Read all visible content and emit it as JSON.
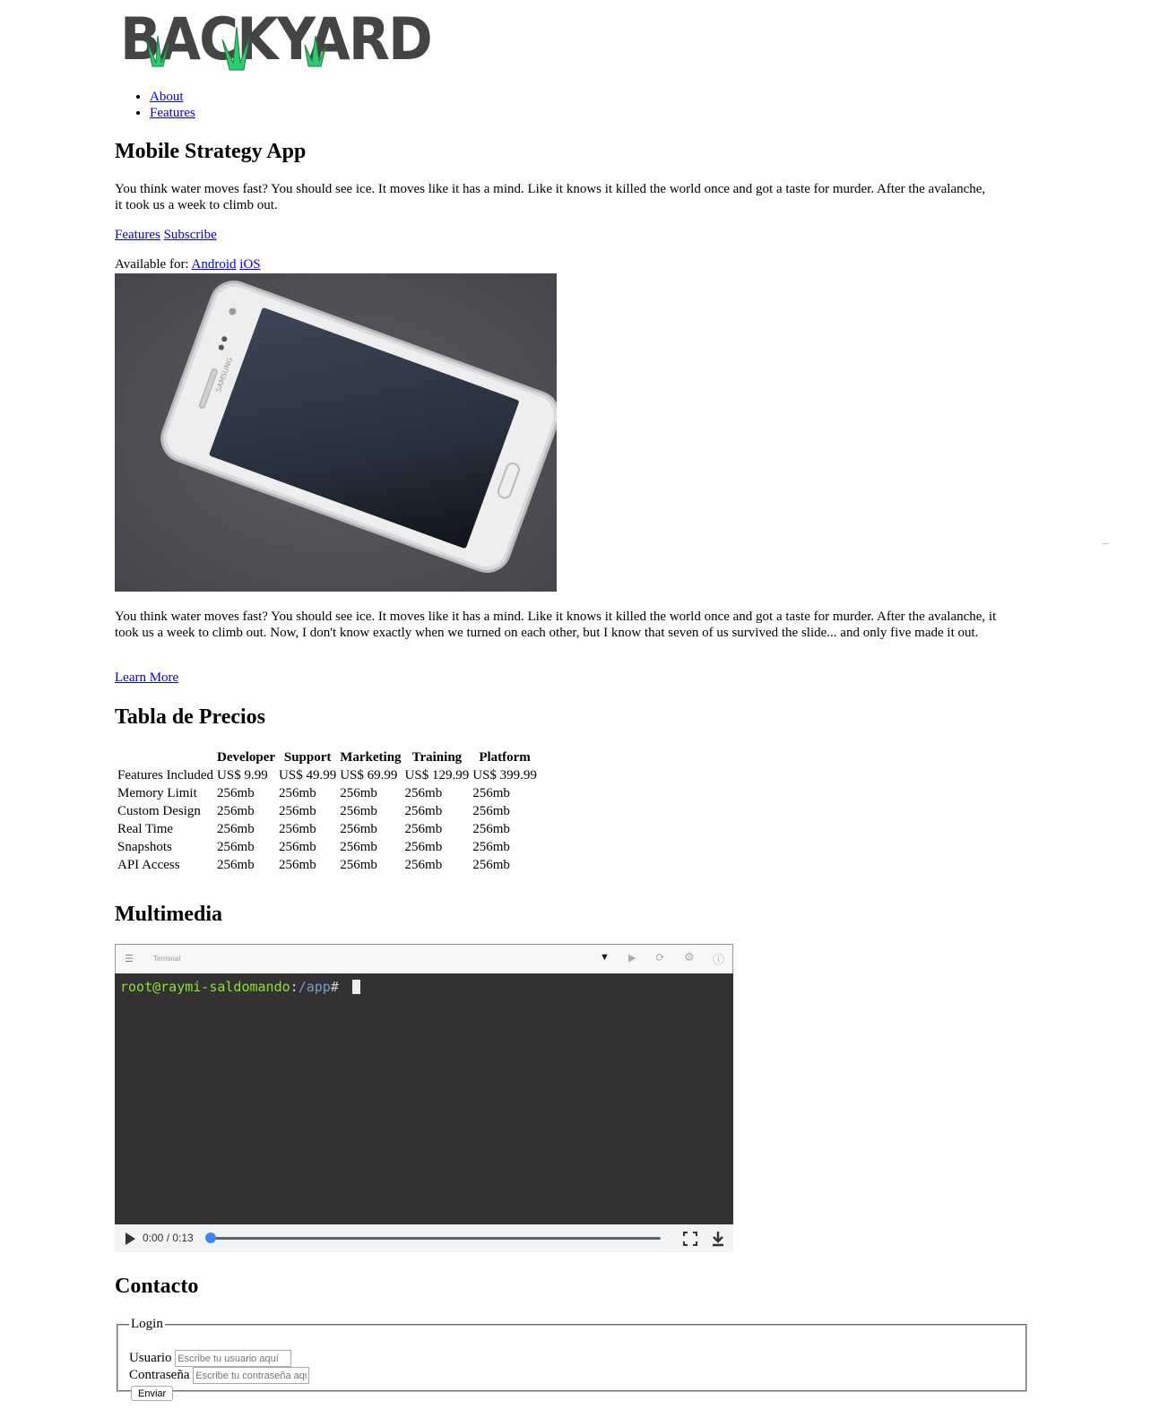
{
  "brand": {
    "logo_text": "BACKYARD",
    "logo_color": "#444444",
    "grass_color": "#2ecc71"
  },
  "nav": {
    "items": [
      {
        "label": "About"
      },
      {
        "label": "Features"
      }
    ]
  },
  "hero": {
    "title": "Mobile Strategy App",
    "intro": "You think water moves fast? You should see ice. It moves like it has a mind. Like it knows it killed the world once and got a taste for murder. After the avalanche, it took us a week to climb out.",
    "links": {
      "features": "Features",
      "subscribe": "Subscribe"
    },
    "available_label": "Available for:",
    "platforms": {
      "android": "Android",
      "ios": "iOS"
    },
    "phone_brand": "SAMSUNG",
    "body": "You think water moves fast? You should see ice. It moves like it has a mind. Like it knows it killed the world once and got a taste for murder. After the avalanche, it took us a week to climb out. Now, I don't know exactly when we turned on each other, but I know that seven of us survived the slide... and only five made it out.",
    "learn_more": "Learn More"
  },
  "pricing": {
    "title": "Tabla de Precios",
    "headers": [
      "",
      "Developer",
      "Support",
      "Marketing",
      "Training",
      "Platform"
    ],
    "rows": [
      [
        "Features Included",
        "US$ 9.99",
        "US$ 49.99",
        "US$ 69.99",
        "US$ 129.99",
        "US$ 399.99"
      ],
      [
        "Memory Limit",
        "256mb",
        "256mb",
        "256mb",
        "256mb",
        "256mb"
      ],
      [
        "Custom Design",
        "256mb",
        "256mb",
        "256mb",
        "256mb",
        "256mb"
      ],
      [
        "Real Time",
        "256mb",
        "256mb",
        "256mb",
        "256mb",
        "256mb"
      ],
      [
        "Snapshots",
        "256mb",
        "256mb",
        "256mb",
        "256mb",
        "256mb"
      ],
      [
        "API Access",
        "256mb",
        "256mb",
        "256mb",
        "256mb",
        "256mb"
      ]
    ]
  },
  "multimedia": {
    "title": "Multimedia",
    "terminal_tab": "Terminal",
    "prompt_user": "root@raymi-saldomando",
    "prompt_sep": ":",
    "prompt_path": "/app",
    "prompt_hash": "#",
    "time": "0:00 / 0:13",
    "progress": 0.0,
    "colors": {
      "terminal_bg": "#333132",
      "user": "#8ae234",
      "path": "#729fcf",
      "seek": "#4285f4"
    }
  },
  "contact": {
    "title": "Contacto",
    "legend": "Login",
    "user_label": "Usuario",
    "user_placeholder": "Escribe tu usuario aquí",
    "pass_label": "Contraseña",
    "pass_placeholder": "Escribe tu contraseña aquí",
    "submit": "Enviar"
  }
}
